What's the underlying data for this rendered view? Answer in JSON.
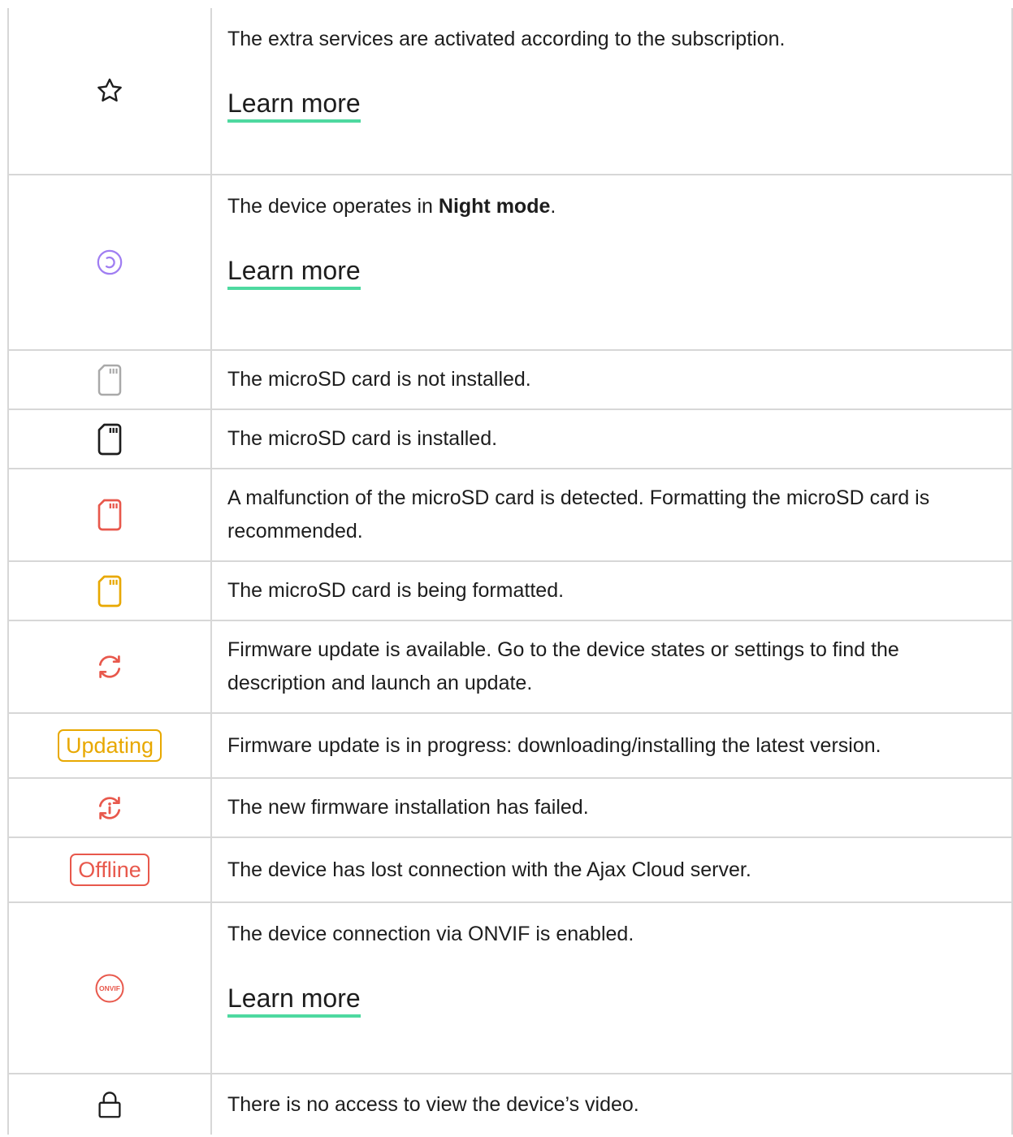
{
  "colors": {
    "text": "#1d1d1d",
    "border": "#d7d7d7",
    "link_underline": "#4ed9a0",
    "purple": "#a07ef2",
    "gray": "#a9a9a9",
    "red": "#e8584c",
    "yellow": "#e8a800"
  },
  "rows": [
    {
      "icon": "star-icon",
      "text": "The extra services are activated according to the subscription.",
      "link": "Learn more"
    },
    {
      "icon": "night-mode-icon",
      "text_before": "The device operates in ",
      "text_bold": "Night mode",
      "text_after": ".",
      "link": "Learn more"
    },
    {
      "icon": "sd-card-gray-icon",
      "text": "The microSD card is not installed."
    },
    {
      "icon": "sd-card-black-icon",
      "text": "The microSD card is installed."
    },
    {
      "icon": "sd-card-red-icon",
      "text": "A malfunction of the microSD card is detected. Formatting the microSD card is recommended."
    },
    {
      "icon": "sd-card-yellow-icon",
      "text": "The microSD card is being formatted."
    },
    {
      "icon": "firmware-update-icon",
      "text": "Firmware update is available. Go to the device states or settings to find the description and launch an update."
    },
    {
      "badge": "Updating",
      "text": "Firmware update is in progress: downloading/installing the latest version."
    },
    {
      "icon": "firmware-failed-icon",
      "text": "The new firmware installation has failed."
    },
    {
      "badge": "Offline",
      "text": "The device has lost connection with the Ajax Cloud server."
    },
    {
      "icon": "onvif-icon",
      "icon_text": "ONVIF",
      "text": "The device connection via ONVIF is enabled.",
      "link": "Learn more"
    },
    {
      "icon": "lock-icon",
      "text": "There is no access to view the device’s video."
    }
  ]
}
